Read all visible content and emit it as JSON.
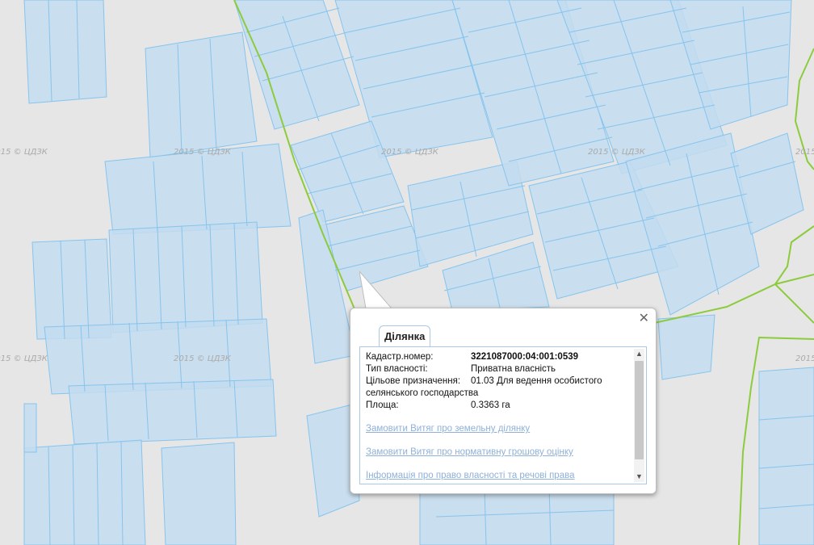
{
  "map": {
    "watermark": "2015 © ЦДЗК",
    "colors": {
      "background": "#e6e6e6",
      "parcel_fill": "#b8d8f0",
      "parcel_stroke": "#7fc0ec",
      "boundary": "#8ccc3c"
    }
  },
  "popup": {
    "tab_label": "Ділянка",
    "close_icon": "close-icon",
    "fields": [
      {
        "label": "Кадастр.номер:",
        "value": "3221087000:04:001:0539"
      },
      {
        "label": "Тип власності:",
        "value": "Приватна власність"
      },
      {
        "label": "Цільове призначення:",
        "value": "01.03 Для ведення особистого селянського господарства"
      },
      {
        "label": "Площа:",
        "value": "0.3363 га"
      }
    ],
    "links": [
      "Замовити Витяг про земельну ділянку",
      "Замовити Витяг про нормативну грошову оцінку",
      "Інформація про право власності та речові права"
    ]
  }
}
